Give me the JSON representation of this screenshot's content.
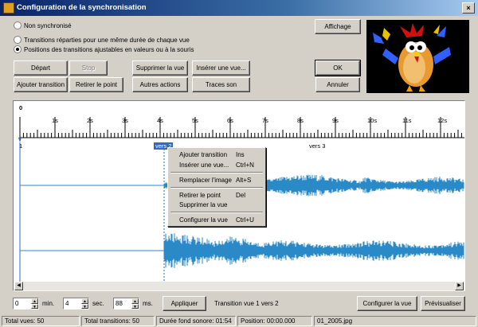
{
  "window": {
    "title": "Configuration de la synchronisation",
    "close_label": "×"
  },
  "options": {
    "radio1": "Non synchronisé",
    "radio2": "Transitions réparties pour une même durée de chaque vue",
    "radio3": "Positions des transitions ajustables en valeurs ou à la souris",
    "selected": 3
  },
  "buttons": {
    "depart": "Départ",
    "stop": "Stop",
    "supprimer_vue": "Supprimer la vue",
    "inserer_vue": "Insérer une vue...",
    "ajouter_transition": "Ajouter transition",
    "retirer_point": "Retirer le point",
    "autres_actions": "Autres actions",
    "traces_son": "Traces son",
    "affichage": "Affichage",
    "ok": "OK",
    "annuler": "Annuler",
    "appliquer": "Appliquer",
    "configurer_vue": "Configurer la vue",
    "previsualiser": "Prévisualiser"
  },
  "timeline": {
    "origin_label": "0",
    "tick_labels": [
      "1s",
      "2s",
      "3s",
      "4s",
      "5s",
      "6s",
      "7s",
      "8s",
      "9s",
      "10s",
      "11s",
      "12s"
    ],
    "markers": {
      "start": "1",
      "vers2": "vers 2",
      "vers3": "vers 3"
    }
  },
  "context_menu": {
    "items": [
      {
        "label": "Ajouter transition",
        "shortcut": "Ins"
      },
      {
        "label": "Insérer une vue...",
        "shortcut": "Ctrl+N"
      },
      {
        "label": "Remplacer l'image",
        "shortcut": "Alt+S"
      },
      {
        "label": "Retirer le point",
        "shortcut": "Del"
      },
      {
        "label": "Supprimer la vue",
        "shortcut": ""
      },
      {
        "label": "Configurer la vue",
        "shortcut": "Ctrl+U"
      }
    ]
  },
  "time_inputs": {
    "min_value": "0",
    "min_unit": "min.",
    "sec_value": "4",
    "sec_unit": "sec.",
    "ms_value": "88",
    "ms_unit": "ms."
  },
  "transition_info": "Transition vue 1 vers 2",
  "status": {
    "total_vues": "Total vues: 50",
    "total_transitions": "Total transitions: 50",
    "duree": "Durée fond sonore: 01:54",
    "position": "Position: 00:00.000",
    "file": "01_2005.jpg"
  },
  "colors": {
    "title_bar": "#0a246a",
    "waveform": "#2a8ac8",
    "selection": "#316ac5"
  }
}
